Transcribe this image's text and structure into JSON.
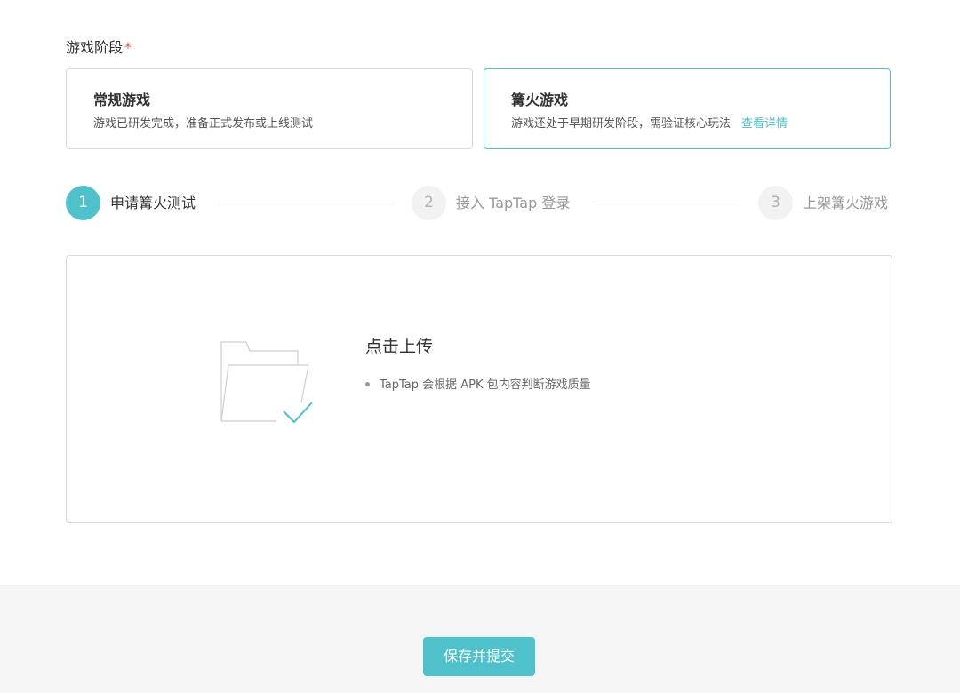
{
  "stage": {
    "label": "游戏阶段",
    "required_mark": "*"
  },
  "options": [
    {
      "title": "常规游戏",
      "description": "游戏已研发完成，准备正式发布或上线测试",
      "selected": false
    },
    {
      "title": "篝火游戏",
      "description": "游戏还处于早期研发阶段，需验证核心玩法",
      "link": "查看详情",
      "selected": true
    }
  ],
  "steps": [
    {
      "number": "1",
      "label": "申请篝火测试",
      "active": true
    },
    {
      "number": "2",
      "label": "接入 TapTap 登录",
      "active": false
    },
    {
      "number": "3",
      "label": "上架篝火游戏",
      "active": false
    }
  ],
  "upload": {
    "title": "点击上传",
    "hint": "TapTap 会根据 APK 包内容判断游戏质量",
    "icon": "folder-check-icon"
  },
  "footer": {
    "submit_label": "保存并提交"
  },
  "colors": {
    "accent": "#4ec1cb",
    "required": "#f5574f",
    "footer_bg": "#f5f5f5"
  }
}
